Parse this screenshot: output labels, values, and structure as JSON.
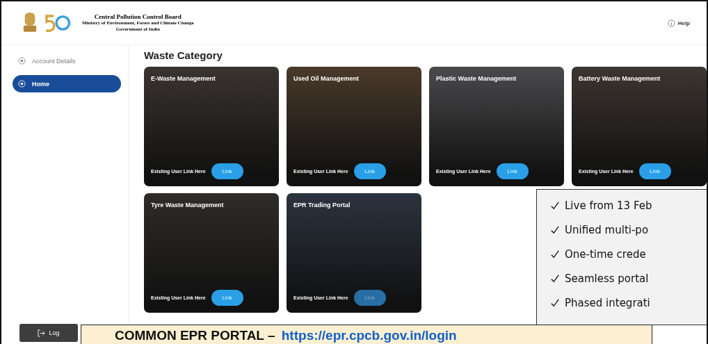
{
  "header": {
    "org_name": "Central Pollution Control Board",
    "ministry": "Ministry of Environment, Forest and Climate Change",
    "government": "Government of India",
    "help": "Help"
  },
  "sidebar": {
    "items": [
      {
        "label": "Account Details",
        "selected": false
      },
      {
        "label": "Home",
        "selected": true
      }
    ],
    "logout": "Log"
  },
  "main": {
    "title": "Waste Category",
    "cards": [
      {
        "title": "E-Waste Management",
        "caption": "Existing User Link Here",
        "button": "Link",
        "disabled": false
      },
      {
        "title": "Used Oil Management",
        "caption": "Existing User Link Here",
        "button": "Link",
        "disabled": false
      },
      {
        "title": "Plastic Waste Management",
        "caption": "Existing User Link Here",
        "button": "Link",
        "disabled": false
      },
      {
        "title": "Battery Waste Management",
        "caption": "Existing User Link Here",
        "button": "Link",
        "disabled": false
      },
      {
        "title": "Tyre Waste Management",
        "caption": "Existing User Link Here",
        "button": "Link",
        "disabled": false
      },
      {
        "title": "EPR Trading Portal",
        "caption": "Existing User Link Here",
        "button": "Link",
        "disabled": true
      }
    ]
  },
  "callout": {
    "items": [
      "Live from 13 Feb",
      "Unified multi-po",
      "One-time crede",
      "Seamless portal",
      "Phased integrati"
    ]
  },
  "banner": {
    "label": "COMMON EPR PORTAL – ",
    "link": "https://epr.cpcb.gov.in/login"
  }
}
